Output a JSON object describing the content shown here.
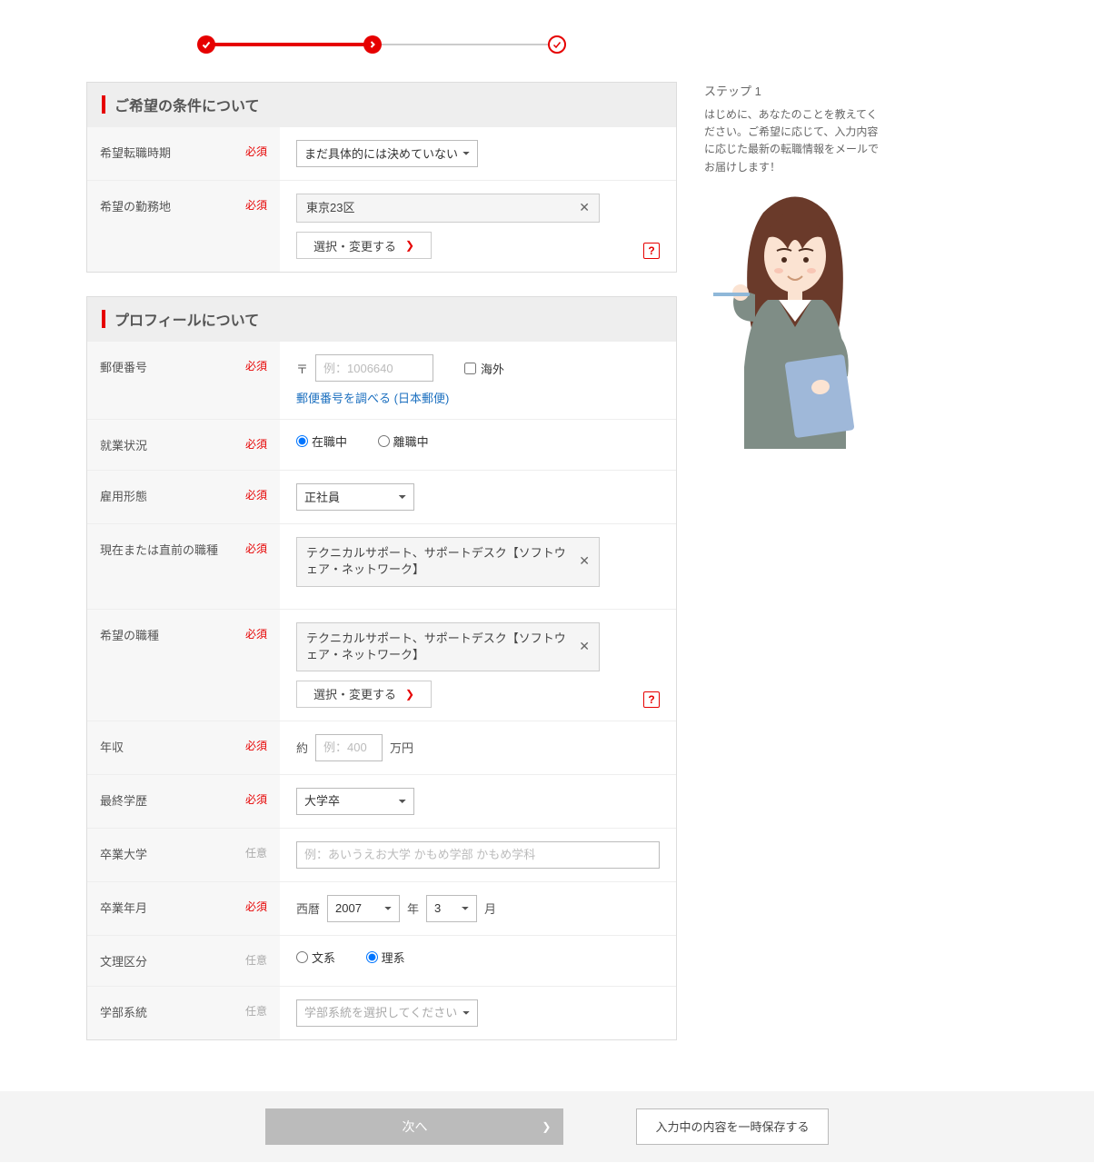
{
  "tags": {
    "required": "必須",
    "optional": "任意"
  },
  "progress": {
    "step_current": 2,
    "steps_total": 3
  },
  "sections": {
    "conditions": {
      "header": "ご希望の条件について",
      "rows": {
        "timing": {
          "label": "希望転職時期",
          "value": "まだ具体的には決めていない"
        },
        "location": {
          "label": "希望の勤務地",
          "chips": [
            "東京23区"
          ],
          "change_btn": "選択・変更する"
        }
      }
    },
    "profile": {
      "header": "プロフィールについて",
      "rows": {
        "postal": {
          "label": "郵便番号",
          "prefix": "〒",
          "placeholder": "例：1006640",
          "overseas_cb": "海外",
          "lookup_link": "郵便番号を調べる (日本郵便)"
        },
        "work": {
          "label": "就業状況",
          "options": [
            "在職中",
            "離職中"
          ],
          "selected": "在職中"
        },
        "emp": {
          "label": "雇用形態",
          "value": "正社員"
        },
        "cur_job": {
          "label": "現在または直前の職種",
          "chip": "テクニカルサポート、サポートデスク【ソフトウェア・ネットワーク】"
        },
        "want_job": {
          "label": "希望の職種",
          "chip": "テクニカルサポート、サポートデスク【ソフトウェア・ネットワーク】",
          "change_btn": "選択・変更する"
        },
        "income": {
          "label": "年収",
          "prefix": "約",
          "placeholder": "例：400",
          "suffix": "万円"
        },
        "edu": {
          "label": "最終学歴",
          "value": "大学卒"
        },
        "univ": {
          "label": "卒業大学",
          "placeholder": "例：あいうえお大学 かもめ学部 かもめ学科"
        },
        "grad": {
          "label": "卒業年月",
          "era": "西暦",
          "year": "2007",
          "year_suffix": "年",
          "month": "3",
          "month_suffix": "月"
        },
        "stream": {
          "label": "文理区分",
          "options": [
            "文系",
            "理系"
          ],
          "selected": "理系"
        },
        "dept": {
          "label": "学部系統",
          "placeholder": "学部系統を選択してください"
        }
      }
    }
  },
  "side": {
    "title": "ステップ 1",
    "text": "はじめに、あなたのことを教えてください。ご希望に応じて、入力内容に応じた最新の転職情報をメールでお届けします！"
  },
  "footer": {
    "next": "次へ",
    "save": "入力中の内容を一時保存する"
  }
}
